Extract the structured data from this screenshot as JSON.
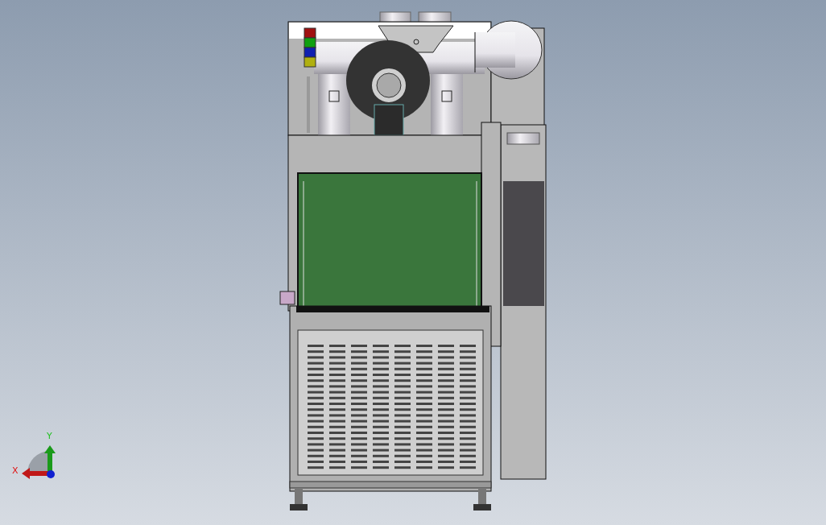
{
  "viewport": {
    "signal_tower": {
      "lights": [
        {
          "color": "#a01010"
        },
        {
          "color": "#10a010"
        },
        {
          "color": "#1020b0"
        },
        {
          "color": "#b0b010"
        }
      ]
    },
    "triad": {
      "x_label": "X",
      "y_label": "Y"
    }
  }
}
